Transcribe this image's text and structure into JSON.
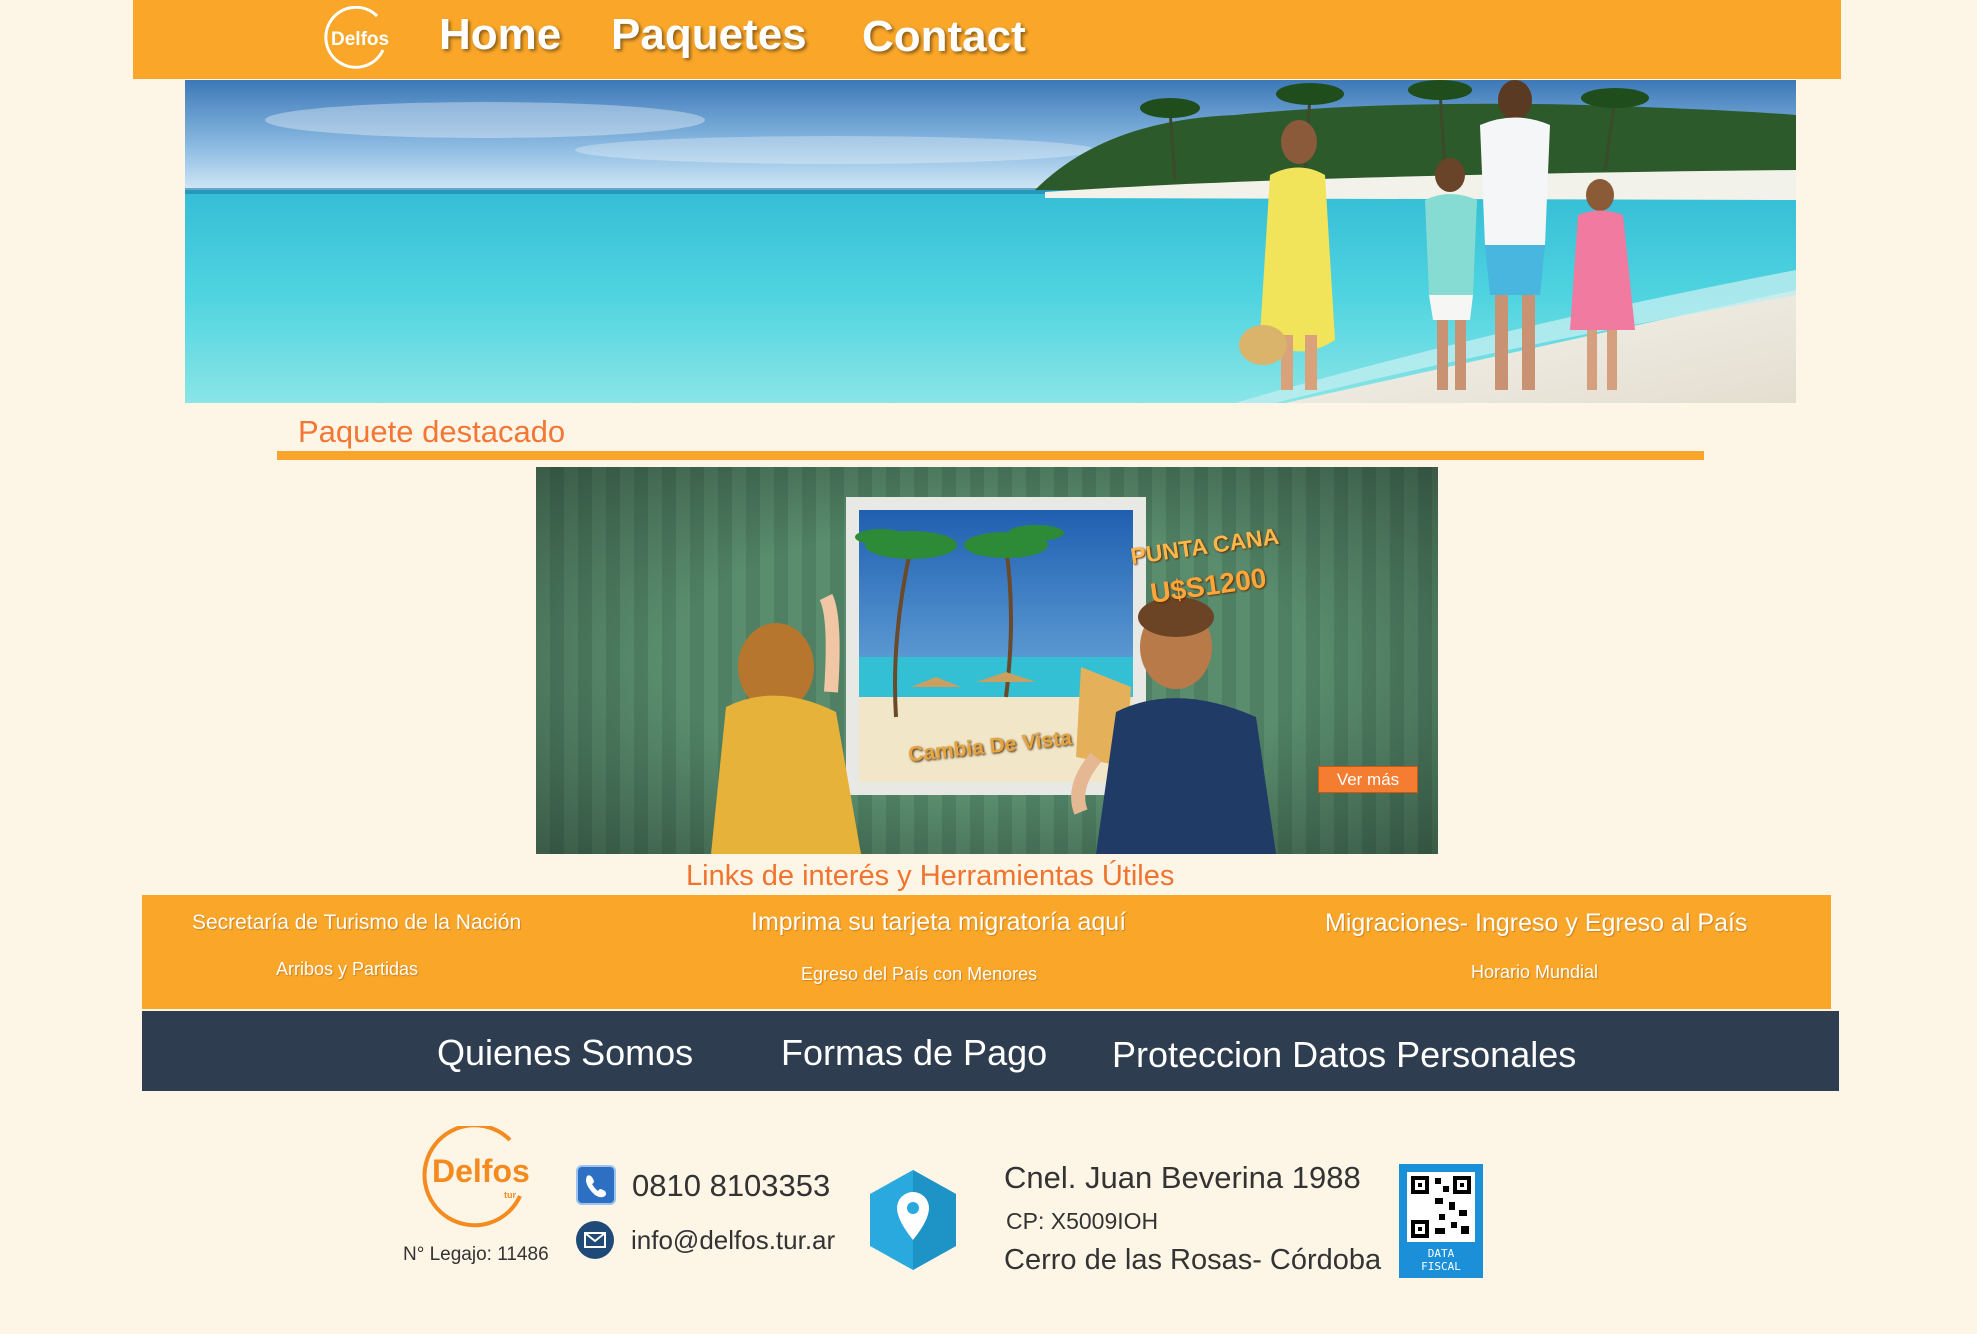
{
  "nav": {
    "logo_text": "Delfos",
    "items": [
      "Home",
      "Paquetes",
      "Contact"
    ]
  },
  "featured": {
    "title": "Paquete destacado",
    "promo": {
      "destination": "PUNTA CANA",
      "price": "U$S1200",
      "slogan": "Cambia De Vista",
      "cta": "Ver más"
    }
  },
  "links": {
    "title": "Links de interés y Herramientas Útiles",
    "items": [
      "Secretaría de Turismo de la Nación",
      "Imprima su tarjeta migratoría aquí",
      "Migraciones- Ingreso y Egreso al País",
      "Arribos y Partidas",
      "Egreso del País con Menores",
      "Horario Mundial"
    ]
  },
  "footer_nav": [
    "Quienes Somos",
    "Formas de Pago",
    "Proteccion Datos Personales"
  ],
  "contact": {
    "logo_text": "Delfos",
    "logo_sub": "tur",
    "legajo": "N° Legajo: 11486",
    "phone": "0810 8103353",
    "email": "info@delfos.tur.ar",
    "address_line1": "Cnel. Juan Beverina 1988",
    "address_line2": "CP: X5009IOH",
    "address_line3": "Cerro de las Rosas- Córdoba",
    "qr_label_1": "DATA",
    "qr_label_2": "FISCAL"
  },
  "colors": {
    "brand_orange": "#faa629",
    "accent_orange": "#f47634",
    "footer_navy": "#2e3d4f",
    "page_bg": "#fdf5e6"
  }
}
